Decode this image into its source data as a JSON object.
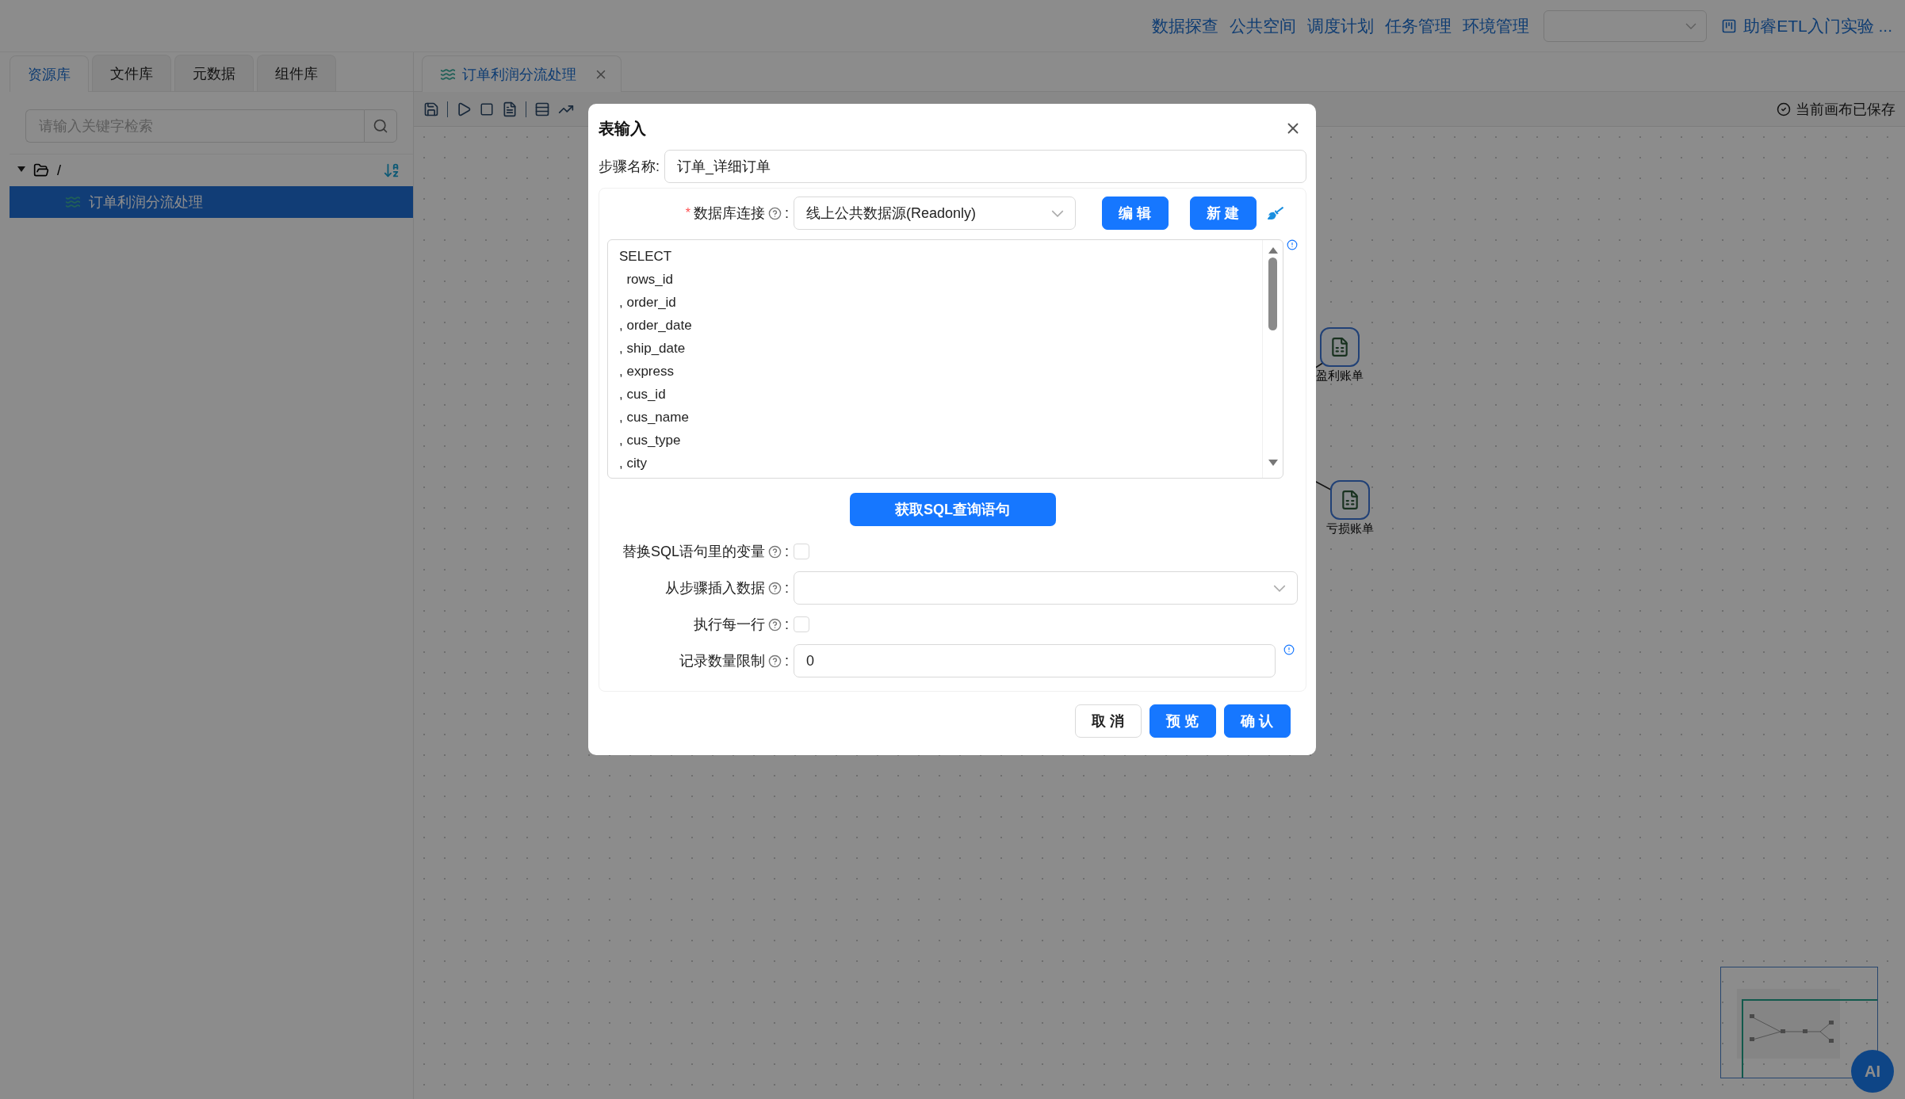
{
  "top_nav": {
    "links": [
      "数据探查",
      "公共空间",
      "调度计划",
      "任务管理",
      "环境管理"
    ],
    "project": "助睿ETL入门实验 ..."
  },
  "left_panel": {
    "tabs": [
      {
        "label": "资源库",
        "selected": true
      },
      {
        "label": "文件库",
        "selected": false
      },
      {
        "label": "元数据",
        "selected": false
      },
      {
        "label": "组件库",
        "selected": false
      }
    ],
    "search": {
      "placeholder": "请输入关键字检索"
    },
    "tree": [
      {
        "label": "/",
        "expanded": true,
        "children": [
          {
            "label": "订单利润分流处理",
            "selected": true
          }
        ]
      }
    ]
  },
  "editor_tab": {
    "label": "订单利润分流处理"
  },
  "save_status": "当前画布已保存",
  "canvas_nodes": [
    {
      "label": "盈利账单"
    },
    {
      "label": "亏损账单"
    }
  ],
  "dialog": {
    "title": "表输入",
    "step_name": {
      "label": "步骤名称:",
      "value": "订单_详细订单"
    },
    "db_connection": {
      "label": "数据库连接",
      "required_mark": "*",
      "colon": ":",
      "value": "线上公共数据源(Readonly)"
    },
    "db_buttons": [
      "编 辑",
      "新 建"
    ],
    "sql_lines": [
      "SELECT",
      "  rows_id",
      ", order_id",
      ", order_date",
      ", ship_date",
      ", express",
      ", cus_id",
      ", cus_name",
      ", cus_type",
      ", city"
    ],
    "get_sql_button": "获取SQL查询语句",
    "options": [
      {
        "kind": "checkbox",
        "label": "替换SQL语句里的变量",
        "colon": ":",
        "checked": false
      },
      {
        "kind": "select",
        "label": "从步骤插入数据",
        "colon": ":"
      },
      {
        "kind": "checkbox",
        "label": "执行每一行",
        "colon": ":",
        "checked": false
      },
      {
        "kind": "input",
        "label": "记录数量限制",
        "colon": ":",
        "value": "0"
      }
    ],
    "footer_buttons": [
      {
        "label": "取 消",
        "primary": false
      },
      {
        "label": "预 览",
        "primary": true
      },
      {
        "label": "确 认",
        "primary": true
      }
    ]
  },
  "ai_button": "AI"
}
